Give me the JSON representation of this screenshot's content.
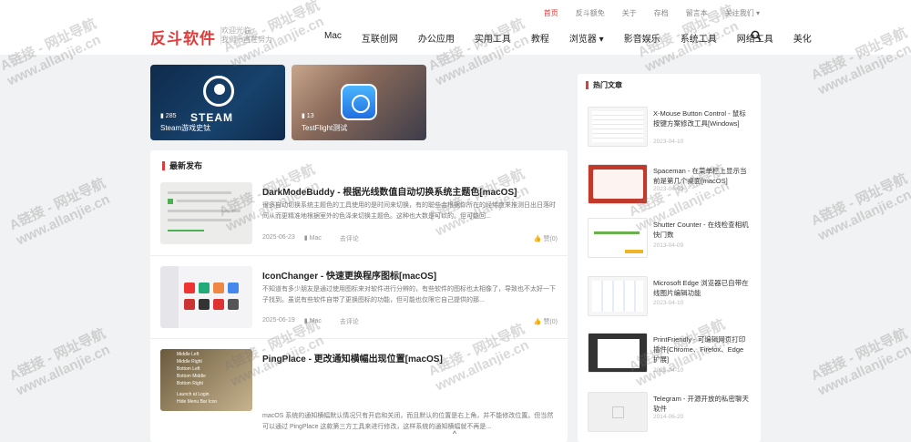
{
  "toplinks": [
    "首页",
    "反斗额免",
    "关于",
    "存档",
    "留言本",
    "关注我们 ▾"
  ],
  "logo": "反斗软件",
  "tagline": [
    "欢迎光临",
    "我们一直在努力"
  ],
  "nav": [
    "Mac",
    "互联创网",
    "办公应用",
    "实用工具",
    "教程",
    "浏览器 ▾",
    "影音娱乐",
    "系统工具",
    "网络工具",
    "美化"
  ],
  "features": [
    {
      "count": "285",
      "title": "Steam游戏史钛",
      "logo_word": "STEAM"
    },
    {
      "count": "13",
      "title": "TestFlight测试"
    }
  ],
  "latest": {
    "heading": "最新发布",
    "posts": [
      {
        "title": "DarkModeBuddy - 根据光线数值自动切换系统主题色[macOS]",
        "excerpt": "很多自动切换系统主题色的工具使用的是时间来切换，有的聪些会根据你所在的经纬度来推测日出日落时间从而更精准地根据室外的色泽来切换主题色。这种也大数是可以的。但可能回...",
        "date": "2025-06-23",
        "category": "Mac",
        "comment": "去评论",
        "likes": "赞(0)"
      },
      {
        "title": "IconChanger - 快速更换程序图标[macOS]",
        "excerpt": "不知道有多少朋友是通过使用图标来对软件进行分辨的，有些软件的图标也太相像了，导致也不太好一下子找到。虽说有些软件自带了更换图标的功能，但可能也仅限它自己提供的那...",
        "date": "2025-06-19",
        "category": "Mac",
        "comment": "去评论",
        "likes": "赞(0)"
      },
      {
        "title": "PingPlace - 更改通知横幅出现位置[macOS]",
        "excerpt": "macOS 系统的通知横幅默认情况只有开启和关闭，而且默认的位置是右上角，并不能修改位置。但当然可以通过 PingPlace 这款第三方工具来进行修改，这样系统的通知横幅就不再是...",
        "thumb_lines": [
          "Middle Left",
          "Middle Right",
          "Bottom Left",
          "Bottom Middle",
          "Bottom Right",
          "Launch at Login",
          "Hide Menu Bar Icon"
        ]
      }
    ]
  },
  "sidebar": {
    "heading": "热门文章",
    "items": [
      {
        "title": "X-Mouse Button Control - 鼠标按键方案修改工具[Windows]",
        "date": "2023-04-10"
      },
      {
        "title": "Spaceman - 在菜单栏上显示当前是第几个桌面[macOS]",
        "date": "2023-04-09"
      },
      {
        "title": "Shutter Counter - 在线检查相机快门数",
        "date": "2013-04-09"
      },
      {
        "title": "Microsoft Edge 浏览器已自带在线图片编辑功能",
        "date": "2023-04-10"
      },
      {
        "title": "PrintFriendly - 可编辑网页打印插件[Chrome、Firefox、Edge 扩展]",
        "date": "2023-04-10"
      },
      {
        "title": "Telegram - 开源开放的私密聊天软件",
        "date": "2014-06-20"
      }
    ]
  },
  "watermark": {
    "line1": "A链接 - 网址导航",
    "line2": "www.allanjie.cn"
  },
  "scroll_top_label": "^",
  "colors": {
    "accent": "#e03b3b"
  }
}
